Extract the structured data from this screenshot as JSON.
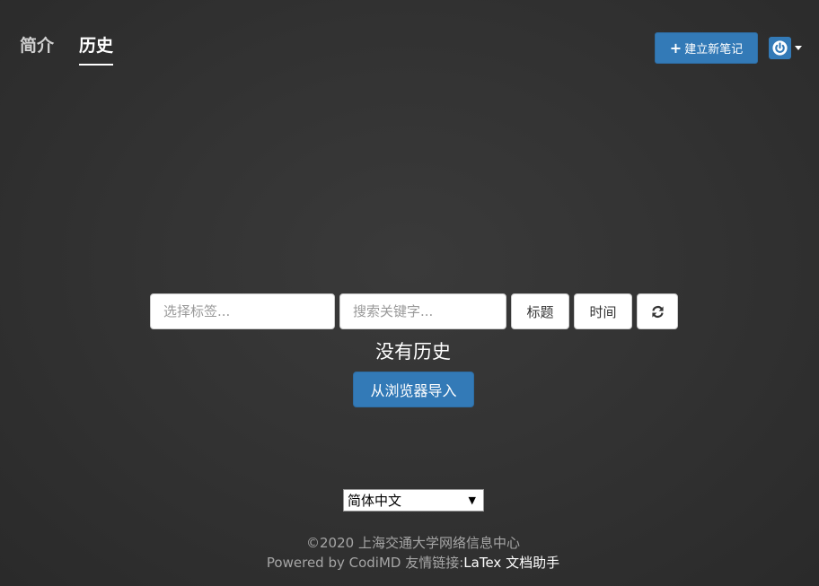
{
  "nav": {
    "tabs": [
      {
        "label": "简介",
        "active": false
      },
      {
        "label": "历史",
        "active": true
      }
    ]
  },
  "header": {
    "new_note_icon": "plus-icon",
    "new_note_label": "建立新笔记",
    "user_menu_icon": "power-icon"
  },
  "filters": {
    "tag_placeholder": "选择标签...",
    "keyword_placeholder": "搜索关键字...",
    "sort_title_label": "标题",
    "sort_time_label": "时间",
    "refresh_icon": "refresh-icon"
  },
  "main": {
    "empty_text": "没有历史",
    "import_label": "从浏览器导入"
  },
  "language": {
    "selected": "简体中文"
  },
  "footer": {
    "copyright": "©2020 上海交通大学网络信息中心",
    "powered": "Powered by CodiMD 友情链接:",
    "link_label": "LaTex 文档助手"
  },
  "colors": {
    "background": "#333333",
    "accent": "#337ab7"
  }
}
